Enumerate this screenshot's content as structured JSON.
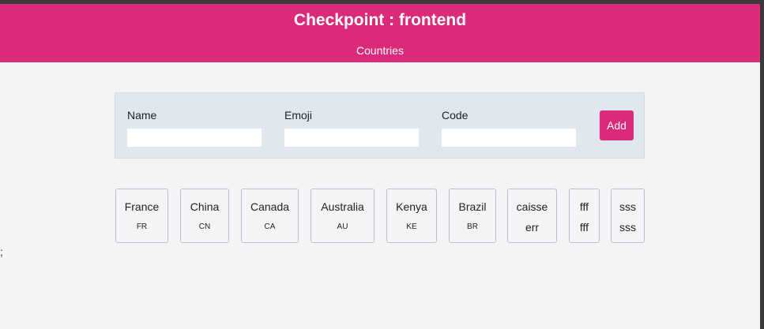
{
  "header": {
    "title": "Checkpoint : frontend",
    "nav_link": "Countries"
  },
  "stray_char": ";",
  "form": {
    "fields": [
      {
        "label": "Name",
        "value": ""
      },
      {
        "label": "Emoji",
        "value": ""
      },
      {
        "label": "Code",
        "value": ""
      }
    ],
    "submit_label": "Add"
  },
  "countries": [
    {
      "name": "France",
      "sub": "FR"
    },
    {
      "name": "China",
      "sub": "CN"
    },
    {
      "name": "Canada",
      "sub": "CA"
    },
    {
      "name": "Australia",
      "sub": "AU"
    },
    {
      "name": "Kenya",
      "sub": "KE"
    },
    {
      "name": "Brazil",
      "sub": "BR"
    },
    {
      "name": "caisse",
      "sub": "err"
    },
    {
      "name": "fff",
      "sub": "fff"
    },
    {
      "name": "sss",
      "sub": "sss"
    }
  ],
  "colors": {
    "accent": "#dc2a7a",
    "panel": "#e1e7ef",
    "background": "#f4f4f4",
    "card_border": "#b9c0d1"
  }
}
